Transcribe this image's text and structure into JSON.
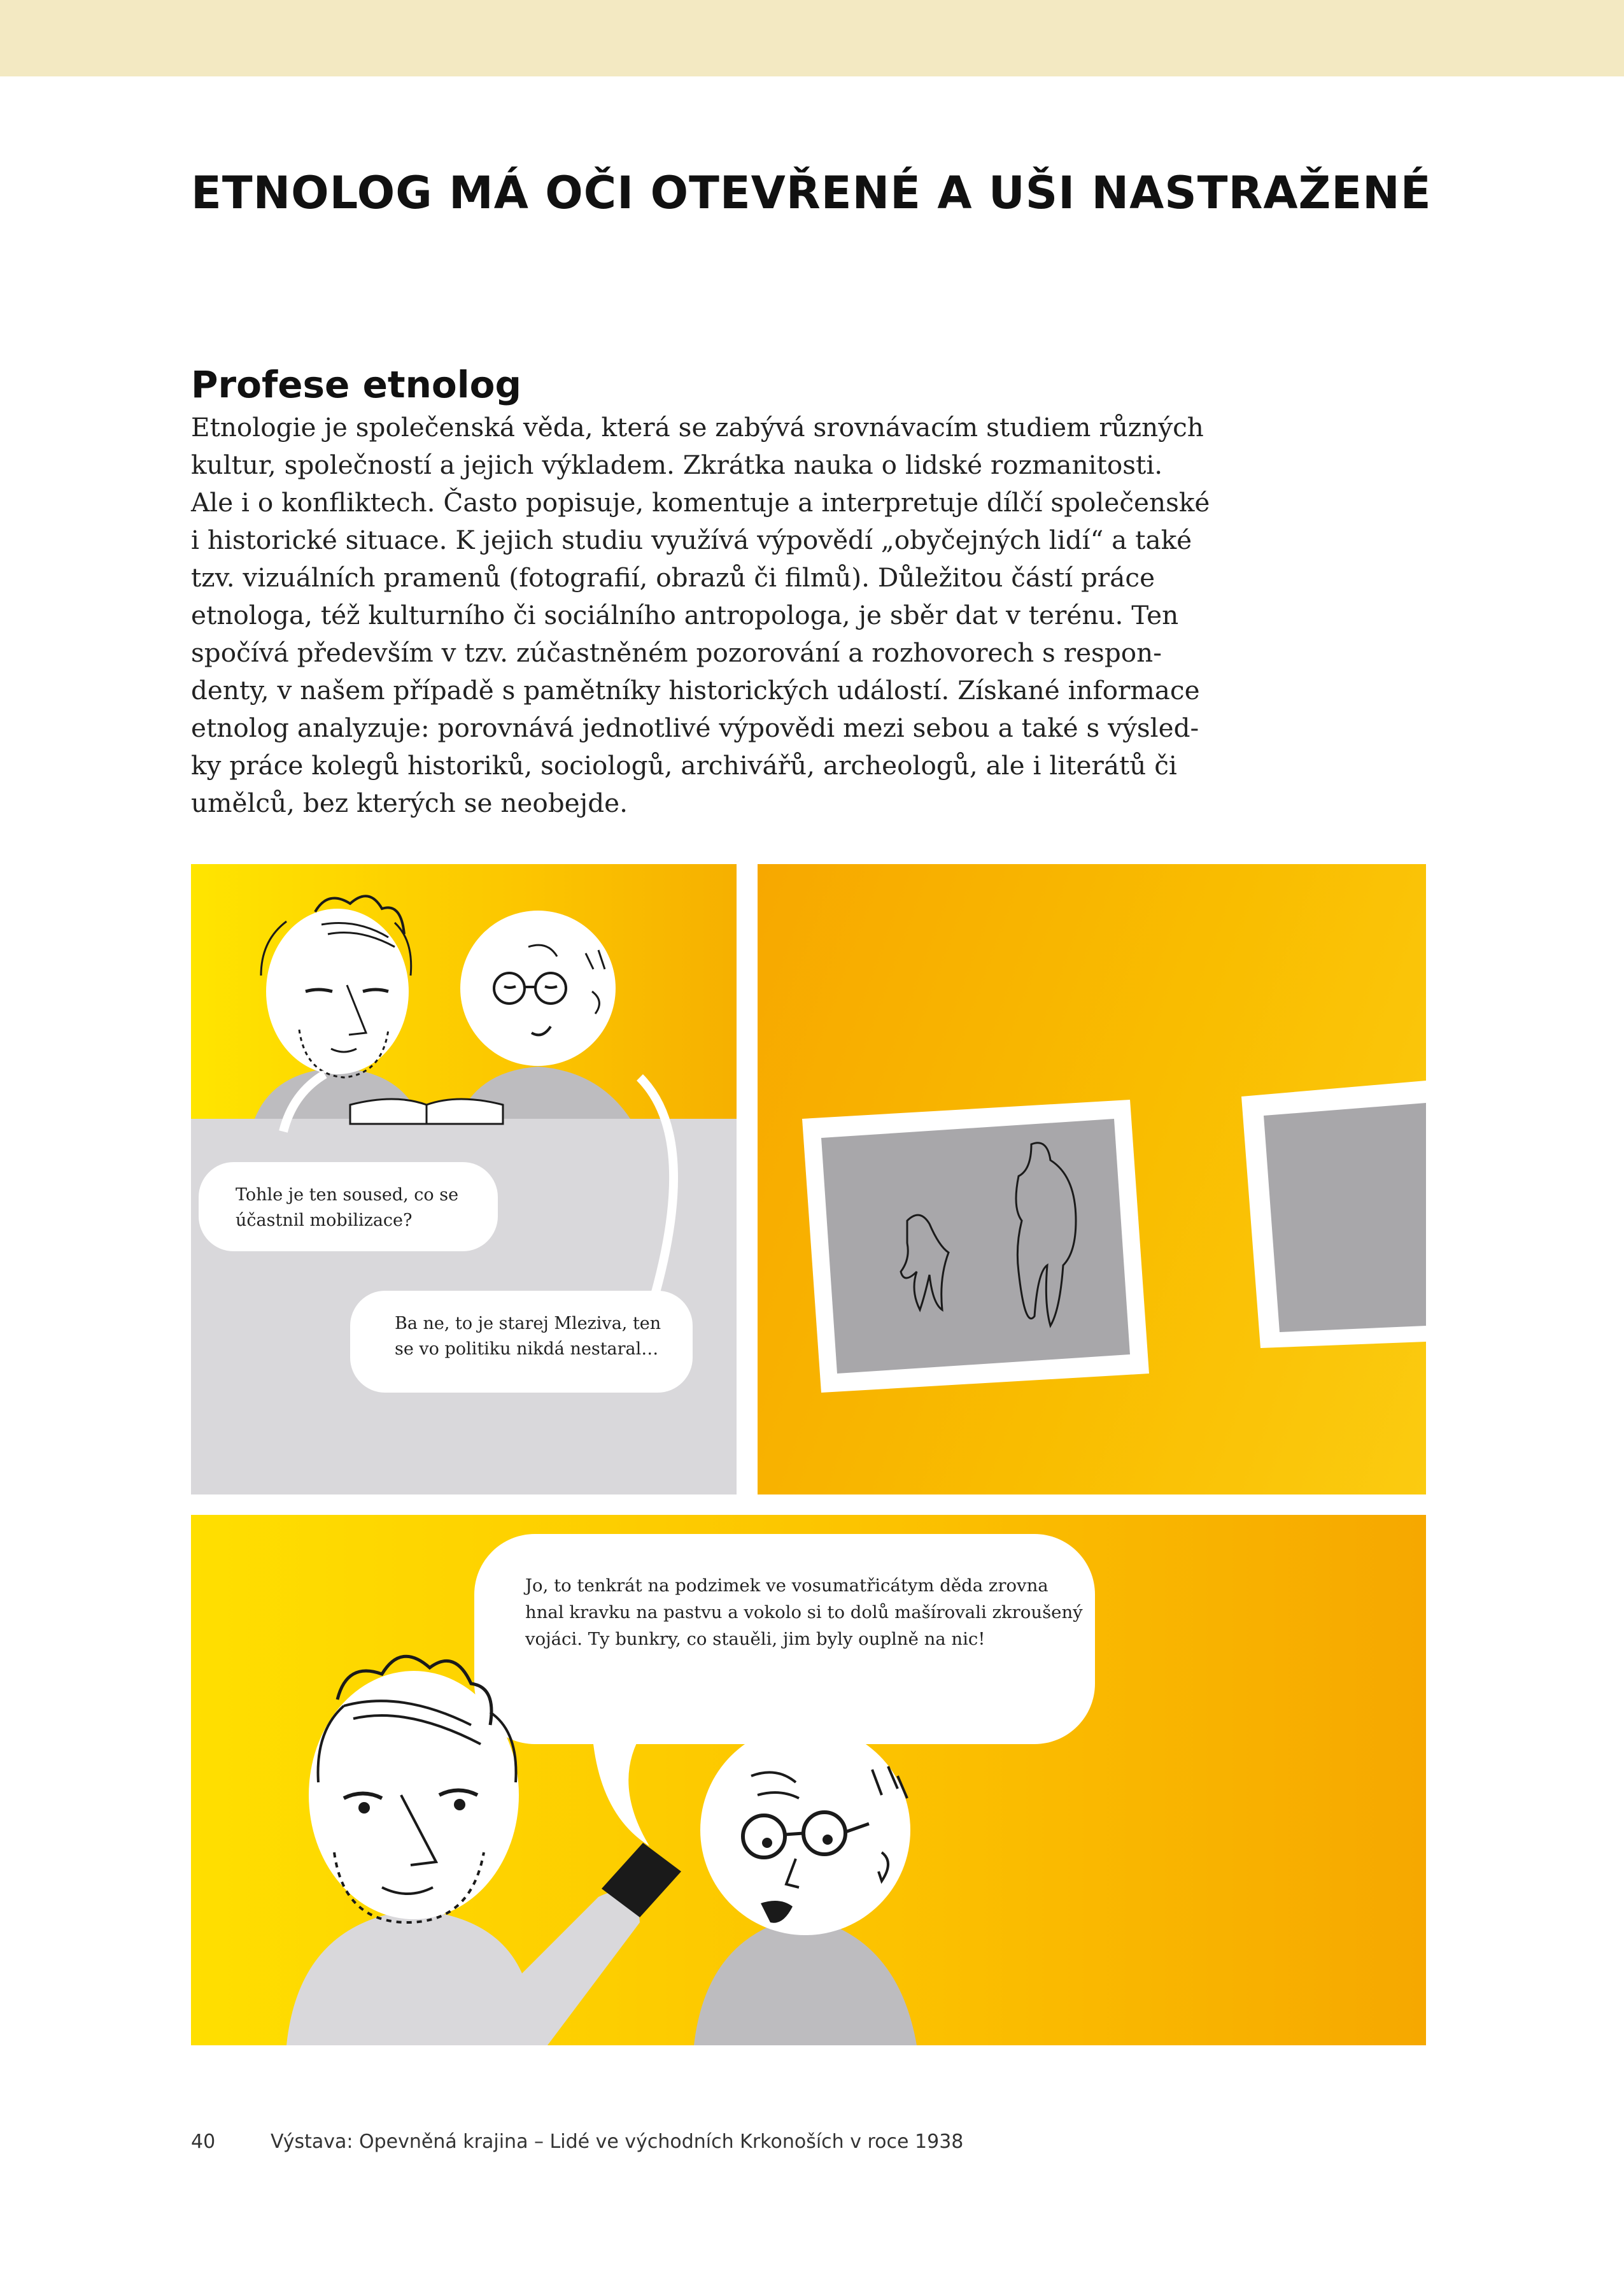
{
  "title": "ETNOLOG MÁ OČI OTEVŘENÉ A UŠI NASTRAŽENÉ",
  "section": {
    "heading": "Profese etnolog",
    "lines": [
      "Etnologie je společenská věda, která se zabývá srovnávacím studiem různých",
      "kultur, společností a jejich výkladem. Zkrátka nauka o lidské rozmanitosti.",
      "Ale i o konfliktech. Často popisuje, komentuje a interpretuje dílčí společenské",
      "i historické situace. K jejich studiu využívá výpovědí „obyčejných lidí“ a také",
      "tzv. vizuálních pramenů (fotografií, obrazů či filmů). Důležitou částí práce",
      "etnologa, též kulturního či sociálního antropologa, je sběr dat v terénu. Ten",
      "spočívá především v tzv. zúčastněném pozorování a rozhovorech s respon-",
      "denty, v našem případě s pamětníky historických událostí. Získané informace",
      "etnolog analyzuje: porovnává jednotlivé výpovědi mezi sebou a také s výsled-",
      "ky práce kolegů historiků, sociologů, archivářů, archeologů, ale i literátů či",
      "umělců, bez kterých se neobejde."
    ]
  },
  "comic": {
    "panel1": {
      "bubble1_lines": [
        "Tohle je ten soused, co se",
        "účastnil mobilizace?"
      ],
      "bubble2_lines": [
        "Ba ne, to je starej Mleziva, ten",
        "se vo politiku nikdá nestaral…"
      ]
    },
    "panel3": {
      "bubble_lines": [
        "Jo, to tenkrát na podzimek ve vosumatřicátym děda zrovna",
        "hnal kravku na pastvu a vokolo si to dolů mašírovali zkroušený",
        "vojáci. Ty bunkry, co stauěli, jim byly ouplně na nic!"
      ]
    }
  },
  "footer": {
    "page_number": "40",
    "text": "Výstava: Opevněná krajina – Lidé ve východních Krkonoších v roce 1938"
  },
  "colors": {
    "header_band": "#f3e9c2",
    "panel_yellow": "#ffe500",
    "panel_orange": "#f6a800",
    "table_gray": "#d9d8db",
    "body_gray": "#bdbcbf"
  }
}
